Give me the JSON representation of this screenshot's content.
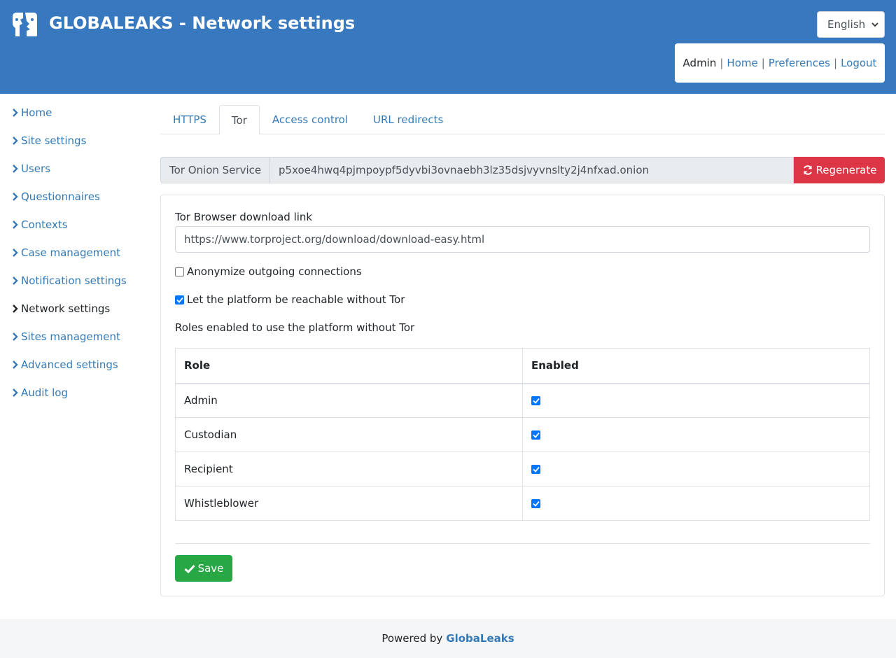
{
  "header": {
    "title": "GLOBALEAKS - Network settings",
    "language": "English",
    "logo_icon": "globaleaks-logo-icon"
  },
  "user_menu": {
    "user": "Admin",
    "home": "Home",
    "preferences": "Preferences",
    "logout": "Logout"
  },
  "sidebar": {
    "items": [
      {
        "label": "Home",
        "active": false
      },
      {
        "label": "Site settings",
        "active": false
      },
      {
        "label": "Users",
        "active": false
      },
      {
        "label": "Questionnaires",
        "active": false
      },
      {
        "label": "Contexts",
        "active": false
      },
      {
        "label": "Case management",
        "active": false
      },
      {
        "label": "Notification settings",
        "active": false
      },
      {
        "label": "Network settings",
        "active": true
      },
      {
        "label": "Sites management",
        "active": false
      },
      {
        "label": "Advanced settings",
        "active": false
      },
      {
        "label": "Audit log",
        "active": false
      }
    ]
  },
  "tabs": [
    {
      "label": "HTTPS",
      "active": false
    },
    {
      "label": "Tor",
      "active": true
    },
    {
      "label": "Access control",
      "active": false
    },
    {
      "label": "URL redirects",
      "active": false
    }
  ],
  "onion": {
    "label": "Tor Onion Service",
    "value": "p5xoe4hwq4pjmpoypf5dyvbi3ovnaebh3lz35dsjvyvnslty2j4nfxad.onion",
    "regenerate_label": "Regenerate"
  },
  "form": {
    "download_link_label": "Tor Browser download link",
    "download_link_value": "https://www.torproject.org/download/download-easy.html",
    "anonymize_label": "Anonymize outgoing connections",
    "anonymize_checked": false,
    "reachable_label": "Let the platform be reachable without Tor",
    "reachable_checked": true,
    "roles_label": "Roles enabled to use the platform without Tor"
  },
  "roles_table": {
    "headers": [
      "Role",
      "Enabled"
    ],
    "rows": [
      {
        "role": "Admin",
        "enabled": true
      },
      {
        "role": "Custodian",
        "enabled": true
      },
      {
        "role": "Recipient",
        "enabled": true
      },
      {
        "role": "Whistleblower",
        "enabled": true
      }
    ]
  },
  "save_label": "Save",
  "footer": {
    "powered_by": "Powered by",
    "brand": "GlobaLeaks"
  },
  "colors": {
    "header_bg": "#3778be",
    "link": "#337ab7",
    "danger": "#dc3545",
    "success": "#28a745"
  }
}
